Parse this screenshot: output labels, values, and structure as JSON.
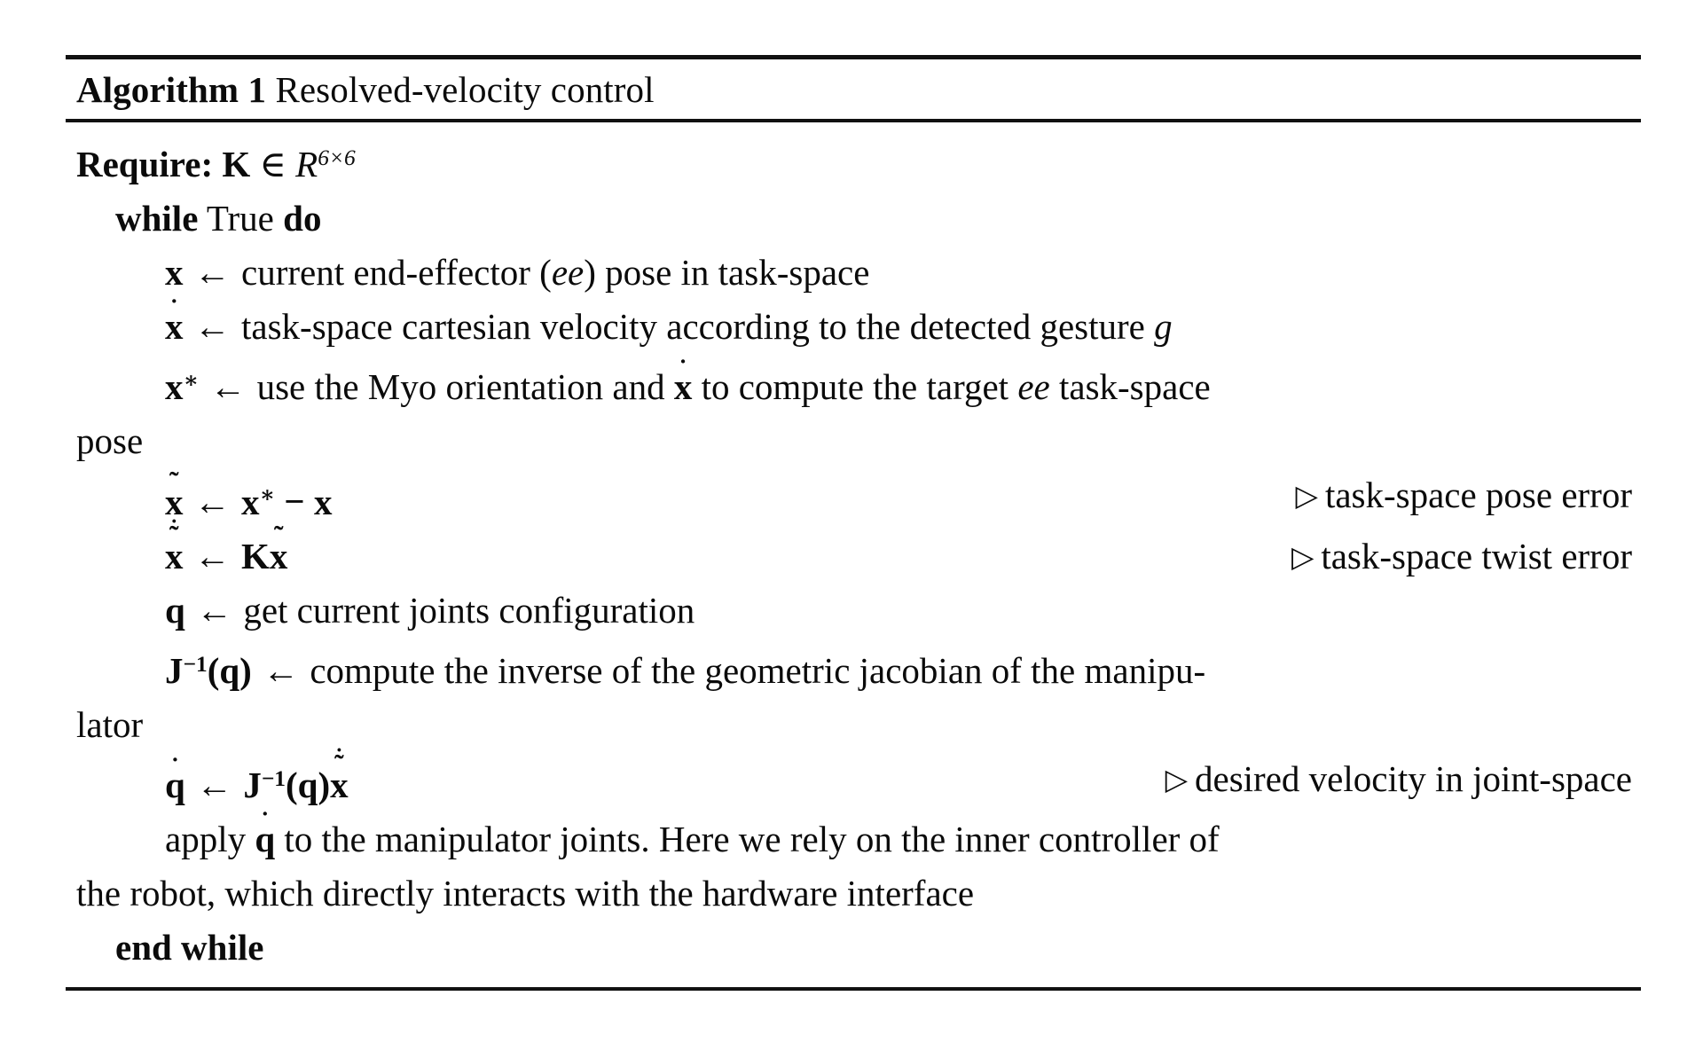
{
  "algorithm": {
    "label": "Algorithm",
    "number": "1",
    "title": "Resolved-velocity control",
    "require": {
      "keyword": "Require:",
      "symbol": "K",
      "relation": "∈",
      "space": "R",
      "exponent": "6×6"
    },
    "loop": {
      "while_keyword": "while",
      "condition": "True",
      "do_keyword": "do",
      "end_keyword": "end while"
    },
    "steps": [
      {
        "id": "step-x",
        "lhs": "x",
        "accent": "none",
        "arrow": "←",
        "text": "current end-effector (ee) pose in task-space",
        "emph": "ee",
        "comment": ""
      },
      {
        "id": "step-xdot",
        "lhs": "x",
        "accent": "dot",
        "arrow": "←",
        "text": "task-space cartesian velocity according to the detected gesture g",
        "emph": "g",
        "comment": ""
      },
      {
        "id": "step-xstar",
        "lhs": "x*",
        "accent": "star",
        "arrow": "←",
        "text": "use the Myo orientation and ẋ to compute the target ee task-space pose",
        "emph": "ee",
        "comment": ""
      },
      {
        "id": "step-xtilde",
        "lhs": "x̃",
        "accent": "tilde",
        "arrow": "←",
        "text": "x* − x",
        "comment": "task-space pose error"
      },
      {
        "id": "step-xtildedot",
        "lhs": "x̃̇",
        "accent": "dot-tilde",
        "arrow": "←",
        "text": "Kx̃",
        "comment": "task-space twist error"
      },
      {
        "id": "step-q",
        "lhs": "q",
        "accent": "none",
        "arrow": "←",
        "text": "get current joints configuration",
        "comment": ""
      },
      {
        "id": "step-jinv",
        "lhs": "J⁻¹(q)",
        "accent": "none",
        "arrow": "←",
        "text": "compute the inverse of the geometric jacobian of the manipu-lator",
        "comment": ""
      },
      {
        "id": "step-qdot",
        "lhs": "q̇",
        "accent": "dot",
        "arrow": "←",
        "text": "J⁻¹(q)x̃̇",
        "comment": "desired velocity in joint-space"
      },
      {
        "id": "step-apply",
        "lhs": "",
        "accent": "none",
        "arrow": "",
        "text": "apply q̇ to the manipulator joints. Here we rely on the inner controller of the robot, which directly interacts with the hardware interface",
        "comment": ""
      }
    ],
    "fragments": {
      "current_ee": "current end-effector",
      "ee_paren_open": "(",
      "ee_emph": "ee",
      "ee_paren_close": ")",
      "pose_in_task_space": "pose in task-space",
      "task_space_cart_vel": "task-space cartesian velocity according to the detected gesture",
      "gesture_symbol": "g",
      "use_myo": "use the Myo orientation and",
      "to_compute_target": "to compute the target",
      "ee_task_space": "task-space",
      "pose_wrap": "pose",
      "minus": "−",
      "get_joints": "get current joints configuration",
      "compute_inverse": "compute the inverse of the geometric jacobian of the manipu-",
      "lator_wrap": "lator",
      "apply_word": "apply",
      "apply_rest": "to the manipulator joints. Here we rely on the inner controller of",
      "apply_wrap": "the robot, which directly interacts with the hardware interface",
      "comment_pose_error": "task-space pose error",
      "comment_twist_error": "task-space twist error",
      "comment_joint_velocity": "desired velocity in joint-space",
      "triangle": "▷",
      "arrow_left": "←",
      "exponent_inverse": "−1"
    }
  },
  "colors": {
    "page_background": "#ffffff",
    "text": "#0b0b0b",
    "rule": "#111111"
  }
}
